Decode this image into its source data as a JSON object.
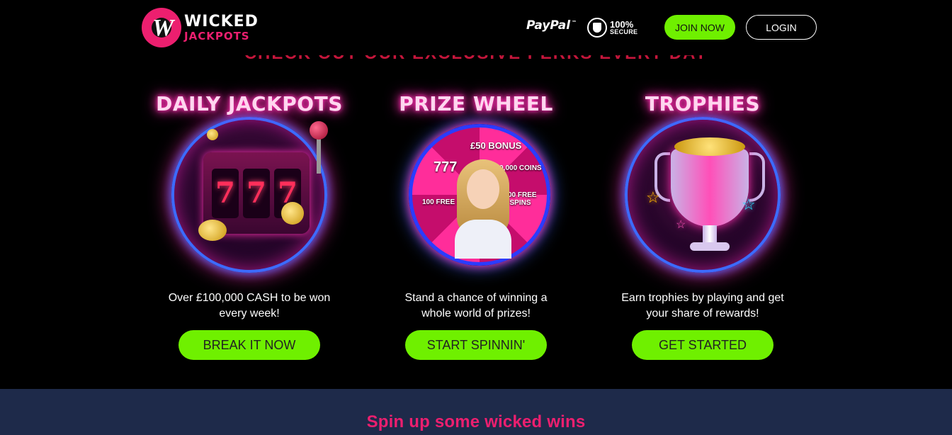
{
  "header": {
    "logo": {
      "line1": "WICKED",
      "line2": "JACKPOTS",
      "badge_letter": "W"
    },
    "paypal_label": "PayPal",
    "paypal_mark": "™",
    "secure": {
      "percent": "100%",
      "label": "SECURE",
      "icon": "shield-icon"
    },
    "join_label": "JOIN NOW",
    "login_label": "LOGIN"
  },
  "partial_heading": "CHECK OUT OUR EXCLUSIVE PERKS EVERY DAY",
  "cards": [
    {
      "art_title": "DAILY JACKPOTS",
      "reels": [
        "7",
        "7",
        "7"
      ],
      "description": "Over £100,000 CASH to be won every week!",
      "button": "BREAK IT NOW"
    },
    {
      "art_title": "PRIZE WHEEL",
      "wheel_labels": [
        "£50 BONUS",
        "100,000 COINS",
        "100 FREE SPINS",
        "777",
        "100 FREE SPINS"
      ],
      "description": "Stand a chance of winning a whole world of prizes!",
      "button": "START SPINNIN'"
    },
    {
      "art_title": "TROPHIES",
      "description": "Earn trophies by playing and get your share of rewards!",
      "button": "GET STARTED"
    }
  ],
  "bottom": {
    "title": "Spin up some wicked wins"
  },
  "colors": {
    "brand_pink": "#ec1f6f",
    "cta_green": "#6ff000",
    "bottom_band": "#1e2a4a",
    "background": "#000000"
  }
}
